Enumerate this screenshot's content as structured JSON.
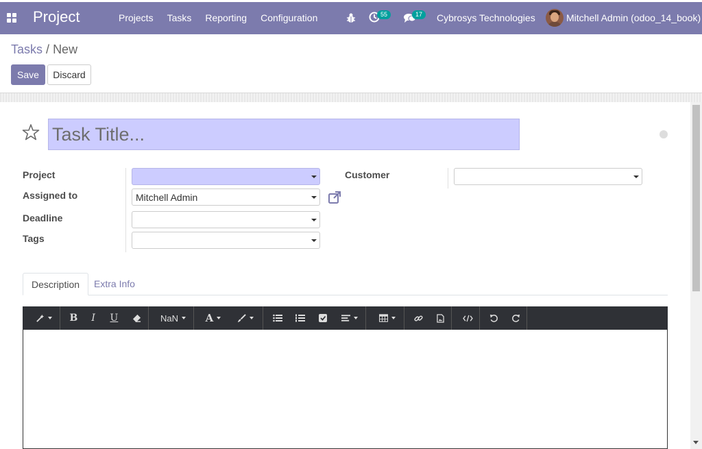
{
  "navbar": {
    "app_name": "Project",
    "menu": [
      "Projects",
      "Tasks",
      "Reporting",
      "Configuration"
    ],
    "activity_count": "55",
    "message_count": "17",
    "company": "Cybrosys Technologies",
    "user": "Mitchell Admin (odoo_14_book)"
  },
  "control_panel": {
    "breadcrumb_parent": "Tasks",
    "breadcrumb_sep": "/",
    "breadcrumb_current": "New",
    "save_label": "Save",
    "discard_label": "Discard"
  },
  "form": {
    "title_placeholder": "Task Title...",
    "fields": {
      "project_label": "Project",
      "project_value": "",
      "assigned_label": "Assigned to",
      "assigned_value": "Mitchell Admin",
      "deadline_label": "Deadline",
      "deadline_value": "",
      "tags_label": "Tags",
      "tags_value": "",
      "customer_label": "Customer",
      "customer_value": ""
    },
    "tabs": [
      "Description",
      "Extra Info"
    ],
    "active_tab": "Description"
  },
  "editor": {
    "font_size_label": "NaN",
    "buttons": [
      "magic-wand",
      "bold",
      "italic",
      "underline",
      "eraser",
      "font-size",
      "font-color",
      "background-color",
      "bullet-list",
      "numbered-list",
      "checklist",
      "paragraph-align",
      "table",
      "link",
      "image",
      "code-view",
      "undo",
      "redo"
    ]
  },
  "colors": {
    "brand": "#7c7bad",
    "required_field": "#ccccff",
    "toolbar": "#2f3136"
  }
}
